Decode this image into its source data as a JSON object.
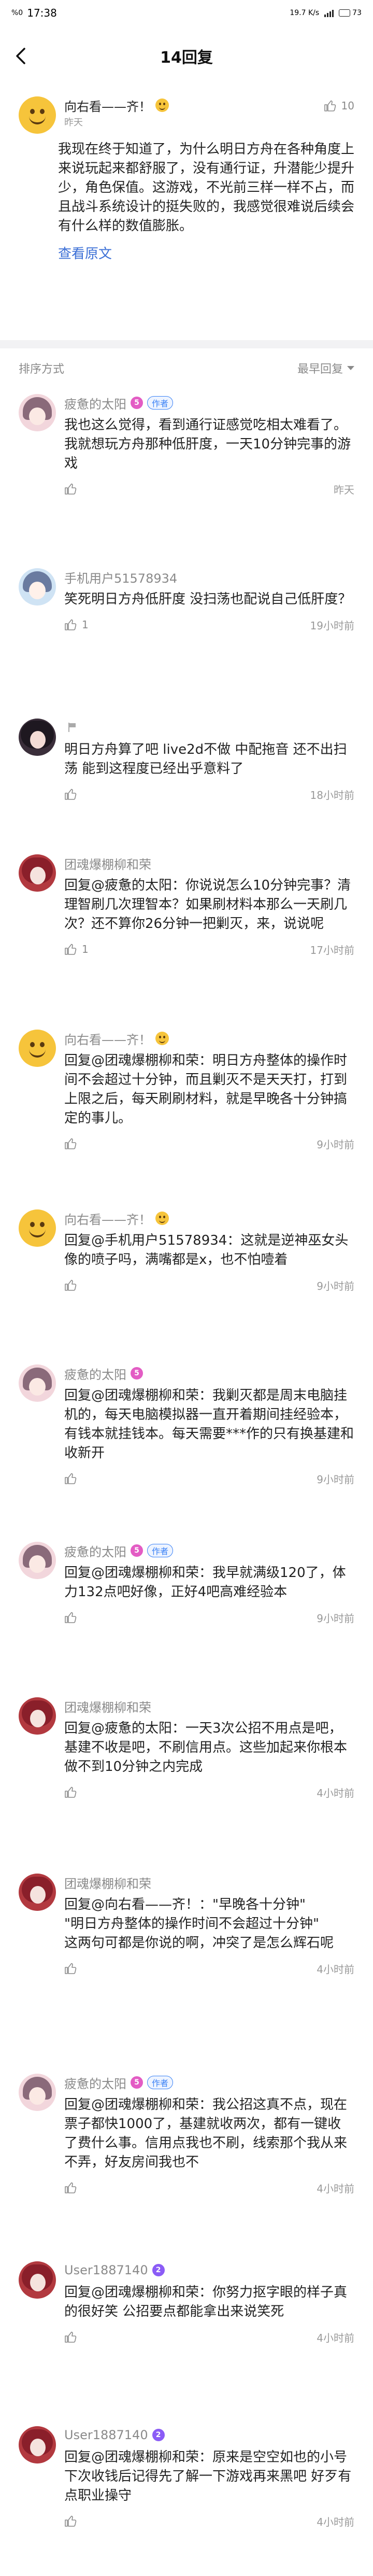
{
  "status_bar": {
    "carrier": "%0",
    "time": "17:38",
    "net": "19.7 K/s",
    "battery": "73"
  },
  "nav": {
    "title": "14回复"
  },
  "main_post": {
    "author": "向右看——齐！",
    "time": "昨天",
    "likes": "10",
    "text": "我现在终于知道了，为什么明日方舟在各种角度上来说玩起来都舒服了，没有通行证，升潜能少提升少，角色保值。这游戏，不光前三样一样不占，而且战斗系统设计的挺失败的，我感觉很难说后续会有什么样的数值膨胀。",
    "view_original": "查看原文"
  },
  "sort": {
    "label": "排序方式",
    "option": "最早回复"
  },
  "author_tag": "作者",
  "replies": [
    {
      "author": "疲惫的太阳",
      "level": "5",
      "author_tag": true,
      "text": "我也这么觉得，看到通行证感觉吃相太难看了。我就想玩方舟那种低肝度，一天10分钟完事的游戏",
      "likes": "",
      "time": "昨天"
    },
    {
      "author": "手机用户51578934",
      "text": "笑死明日方舟低肝度  没扫荡也配说自己低肝度？",
      "likes": "1",
      "time": "19小时前"
    },
    {
      "author": "",
      "text": "明日方舟算了吧 live2d不做 中配拖音 还不出扫荡 能到这程度已经出乎意料了",
      "likes": "",
      "time": "18小时前"
    },
    {
      "author": "团魂爆棚柳和荣",
      "text": "回复@疲惫的太阳：你说说怎么10分钟完事？清理智刷几次理智本？如果刷材料本那么一天刷几次？还不算你26分钟一把剿灭，来，说说呢",
      "likes": "1",
      "time": "17小时前"
    },
    {
      "author": "向右看——齐！",
      "emoji": true,
      "text": "回复@团魂爆棚柳和荣：明日方舟整体的操作时间不会超过十分钟，而且剿灭不是天天打，打到上限之后，每天刷刷材料，就是早晚各十分钟搞定的事儿。",
      "likes": "",
      "time": "9小时前"
    },
    {
      "author": "向右看——齐！",
      "emoji": true,
      "text": "回复@手机用户51578934：这就是逆神巫女头像的喷子吗，满嘴都是x，也不怕噎着",
      "likes": "",
      "time": "9小时前"
    },
    {
      "author": "疲惫的太阳",
      "level": "5",
      "text": "回复@团魂爆棚柳和荣：我剿灭都是周末电脑挂机的，每天电脑模拟器一直开着期间挂经验本，有钱本就挂钱本。每天需要***作的只有换基建和收新开",
      "likes": "",
      "time": "9小时前"
    },
    {
      "author": "疲惫的太阳",
      "level": "5",
      "author_tag": true,
      "text": "回复@团魂爆棚柳和荣：我早就满级120了，体力132点吧好像，正好4吧高难经验本",
      "likes": "",
      "time": "9小时前"
    },
    {
      "author": "团魂爆棚柳和荣",
      "text": "回复@疲惫的太阳：一天3次公招不用点是吧，基建不收是吧，不刷信用点。这些加起来你根本做不到10分钟之内完成",
      "likes": "",
      "time": "4小时前"
    },
    {
      "author": "团魂爆棚柳和荣",
      "text": "回复@向右看——齐！：\"早晚各十分钟\"\n\"明日方舟整体的操作时间不会超过十分钟\"\n这两句可都是你说的啊，冲突了是怎么辉石呢",
      "likes": "",
      "time": "4小时前"
    },
    {
      "author": "疲惫的太阳",
      "level": "5",
      "author_tag": true,
      "text": "回复@团魂爆棚柳和荣：我公招这真不点，现在票子都快1000了，基建就收两次，都有一键收了费什么事。信用点我也不刷，线索那个我从来不弄，好友房间我也不",
      "likes": "",
      "time": "4小时前"
    },
    {
      "author": "User1887140",
      "level": "2",
      "level_violet": true,
      "text": "回复@团魂爆棚柳和荣：你努力抠字眼的样子真的很好笑 公招要点都能拿出来说笑死",
      "likes": "",
      "time": "4小时前"
    },
    {
      "author": "User1887140",
      "level": "2",
      "level_violet": true,
      "text": "回复@团魂爆棚柳和荣：原来是空空如也的小号 下次收钱后记得先了解一下游戏再来黑吧 好歹有点职业操守",
      "likes": "",
      "time": "4小时前"
    }
  ]
}
